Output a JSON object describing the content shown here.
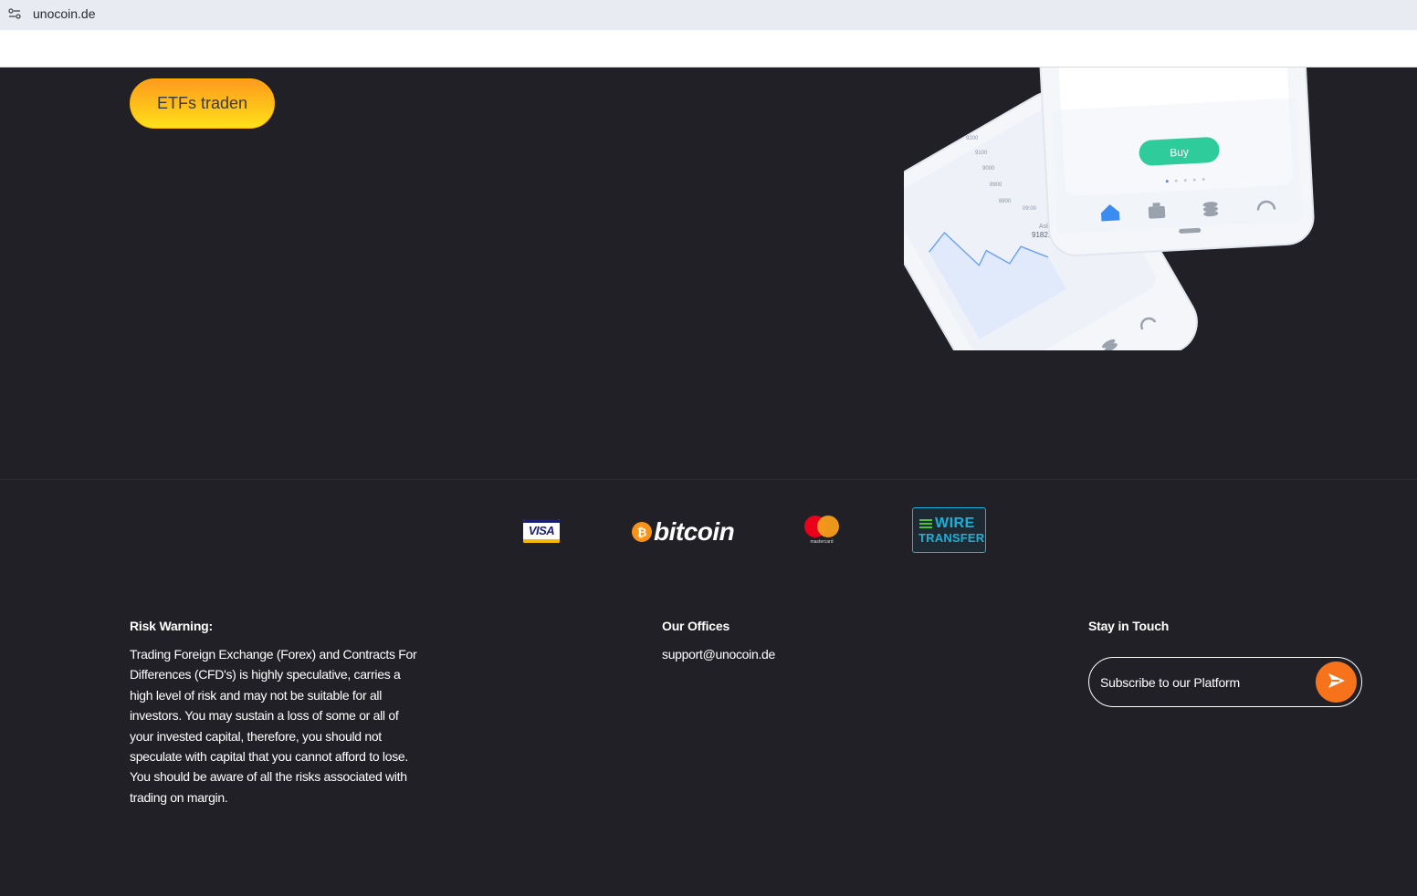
{
  "browser": {
    "url": "unocoin.de",
    "site_info_icon": "tune-icon"
  },
  "hero": {
    "cta_label": "ETFs traden",
    "phone_mockup": {
      "buy_label": "Buy",
      "ask_label": "Ask",
      "ask_value": "9182.51",
      "y_ticks": [
        "9200",
        "9100",
        "9000",
        "8900",
        "8800"
      ],
      "x_tick": "09:00",
      "nav_icons": [
        "home-icon",
        "briefcase-icon",
        "coins-icon",
        "headset-icon"
      ]
    }
  },
  "payments": {
    "visa": "VISA",
    "bitcoin": "bitcoin",
    "bitcoin_symbol": "₿",
    "mastercard": "mastercard",
    "wire_top": "WIRE",
    "wire_bottom": "TRANSFER"
  },
  "footer": {
    "risk_title": "Risk Warning:",
    "risk_text": "Trading Foreign Exchange (Forex) and Contracts For Differences (CFD's) is highly speculative, carries a high level of risk and may not be suitable for all investors. You may sustain a loss of some or all of your invested capital, therefore, you should not speculate with capital that you cannot afford to lose. You should be aware of all the risks associated with trading on margin.",
    "offices_title": "Our Offices",
    "offices_email": "support@unocoin.de",
    "touch_title": "Stay in Touch",
    "subscribe_placeholder": "Subscribe to our Platform"
  },
  "colors": {
    "background": "#212026",
    "accent_orange": "#f7731b",
    "buy_green": "#2ecc9a",
    "cta_gradient_top": "#ff9a1f",
    "cta_gradient_bottom": "#ffe21a"
  }
}
